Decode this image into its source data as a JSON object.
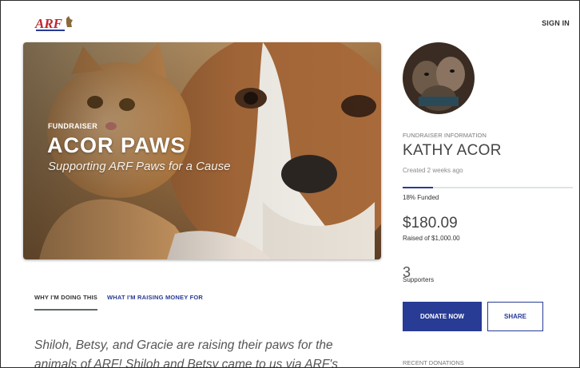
{
  "header": {
    "logo_text": "ARF",
    "sign_in": "SIGN IN"
  },
  "hero": {
    "tag": "FUNDRAISER",
    "title": "ACOR PAWS",
    "subtitle": "Supporting ARF Paws for a Cause"
  },
  "tabs": [
    {
      "label": "WHY I'M DOING THIS"
    },
    {
      "label": "WHAT I'M RAISING MONEY FOR"
    }
  ],
  "story": {
    "text": "Shiloh, Betsy, and Gracie are raising their paws for the animals of ARF! Shiloh and Betsy came to us via ARF's"
  },
  "sidebar": {
    "info_label": "FUNDRAISER INFORMATION",
    "owner_name": "KATHY ACOR",
    "created": "Created 2 weeks ago",
    "funded_fraction": 0.18,
    "funded_label": "18% Funded",
    "raised_amount": "$180.09",
    "raised_of": "Raised of $1,000.00",
    "supporters_count": "3",
    "supporters_label": "Supporters",
    "donate_label": "DONATE NOW",
    "share_label": "SHARE",
    "recent_label": "RECENT DONATIONS"
  },
  "colors": {
    "accent": "#283b95",
    "logo_red": "#c0262d"
  }
}
